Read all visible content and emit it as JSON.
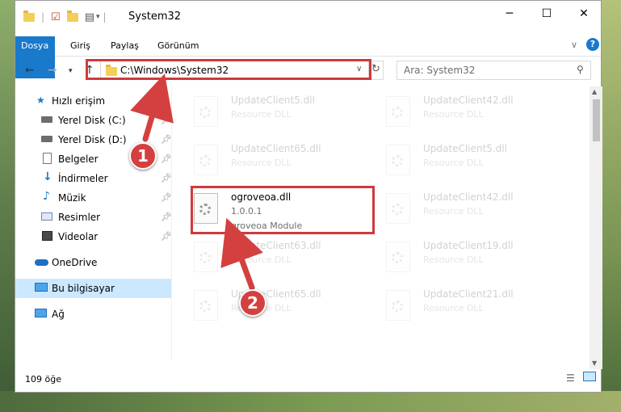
{
  "window": {
    "title": "System32"
  },
  "ribbon": {
    "tabs": [
      "Dosya",
      "Giriş",
      "Paylaş",
      "Görünüm"
    ]
  },
  "address": {
    "path": "C:\\Windows\\System32"
  },
  "search": {
    "placeholder": "Ara: System32"
  },
  "sidebar": {
    "items": [
      {
        "label": "Hızlı erişim",
        "icon": "star-icon"
      },
      {
        "label": "Yerel Disk (C:)",
        "icon": "drive-icon",
        "pinned": true
      },
      {
        "label": "Yerel Disk (D:)",
        "icon": "drive-icon",
        "pinned": true
      },
      {
        "label": "Belgeler",
        "icon": "document-icon",
        "pinned": true
      },
      {
        "label": "İndirmeler",
        "icon": "download-icon",
        "pinned": true
      },
      {
        "label": "Müzik",
        "icon": "music-icon",
        "pinned": true
      },
      {
        "label": "Resimler",
        "icon": "picture-icon",
        "pinned": true
      },
      {
        "label": "Videolar",
        "icon": "video-icon",
        "pinned": true
      },
      {
        "label": "OneDrive",
        "icon": "cloud-icon"
      },
      {
        "label": "Bu bilgisayar",
        "icon": "computer-icon",
        "selected": true
      },
      {
        "label": "Ağ",
        "icon": "network-icon"
      }
    ]
  },
  "files": [
    {
      "name": "UpdateClient5.dll",
      "desc": "Resource DLL"
    },
    {
      "name": "UpdateClient42.dll",
      "desc": "Resource DLL"
    },
    {
      "name": "UpdateClient65.dll",
      "desc": "Resource DLL"
    },
    {
      "name": "UpdateClient5.dll",
      "desc": "Resource DLL"
    },
    {
      "name": "ogroveoa.dll",
      "version": "1.0.0.1",
      "desc": "groveoa Module"
    },
    {
      "name": "UpdateClient42.dll",
      "desc": "Resource DLL"
    },
    {
      "name": "UpdateClient63.dll",
      "desc": "Resource DLL"
    },
    {
      "name": "UpdateClient19.dll",
      "desc": "Resource DLL"
    },
    {
      "name": "UpdateClient65.dll",
      "desc": "Resource DLL"
    },
    {
      "name": "UpdateClient21.dll",
      "desc": "Resource DLL"
    }
  ],
  "status": {
    "count": "109 öğe"
  },
  "markers": [
    "1",
    "2"
  ],
  "colors": {
    "accent": "#1979ca",
    "highlight": "#d03a3a",
    "selection": "#cce8ff"
  }
}
